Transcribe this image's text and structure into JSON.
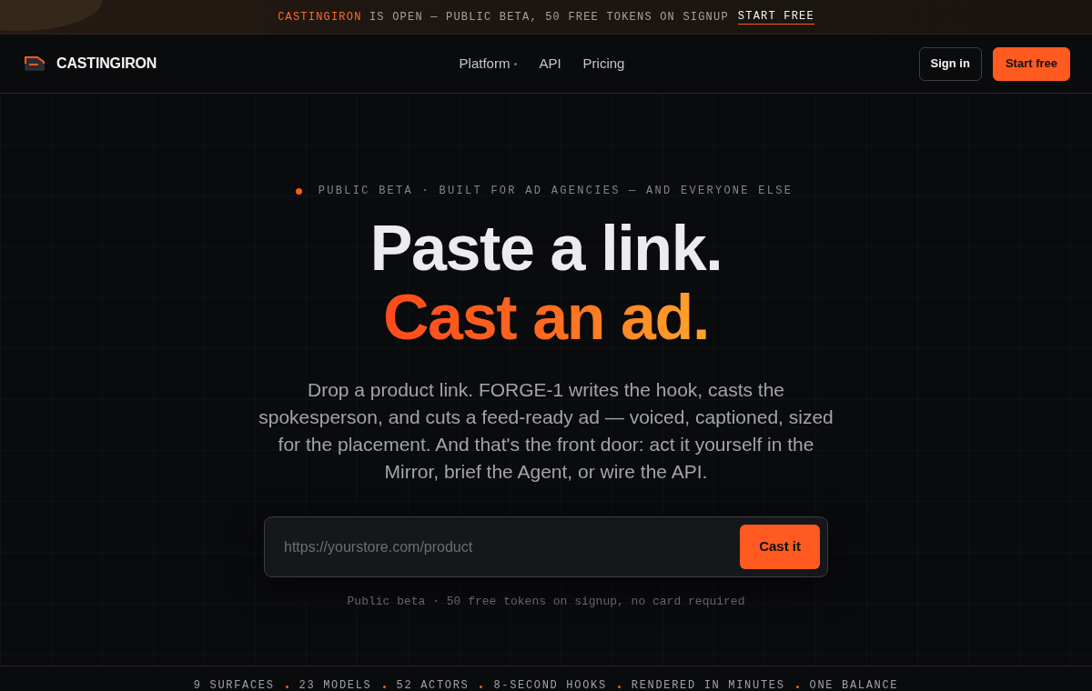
{
  "banner": {
    "brand": "CASTINGIRON",
    "message": "IS OPEN — PUBLIC BETA, 50 FREE TOKENS ON SIGNUP",
    "link": "START FREE"
  },
  "nav": {
    "logo": "CASTINGIRON",
    "links": [
      {
        "label": "Platform",
        "dropdown": true
      },
      {
        "label": "API",
        "dropdown": false
      },
      {
        "label": "Pricing",
        "dropdown": false
      }
    ],
    "buttons": [
      {
        "label": "Sign in",
        "kind": "outline"
      },
      {
        "label": "Start free",
        "kind": "primary"
      }
    ]
  },
  "hero": {
    "eyebrow": "PUBLIC BETA · BUILT FOR AD AGENCIES — AND EVERYONE ELSE",
    "title_line_1": "Paste a link.",
    "title_line_2": "Cast an ad.",
    "description": "Drop a product link. FORGE-1 writes the hook, casts the spokesperson, and cuts a feed-ready ad — voiced, captioned, sized for the placement. And that's the front door: act it yourself in the Mirror, brief the Agent, or wire the API.",
    "url_field": {
      "placeholder": "https://yourstore.com/product"
    },
    "submit": "Cast it",
    "note": "Public beta · 50 free tokens on signup, no card required"
  },
  "stats": [
    "9 SURFACES",
    "23 MODELS",
    "52 ACTORS",
    "8-SECOND HOOKS",
    "RENDERED IN MINUTES",
    "ONE BALANCE"
  ]
}
